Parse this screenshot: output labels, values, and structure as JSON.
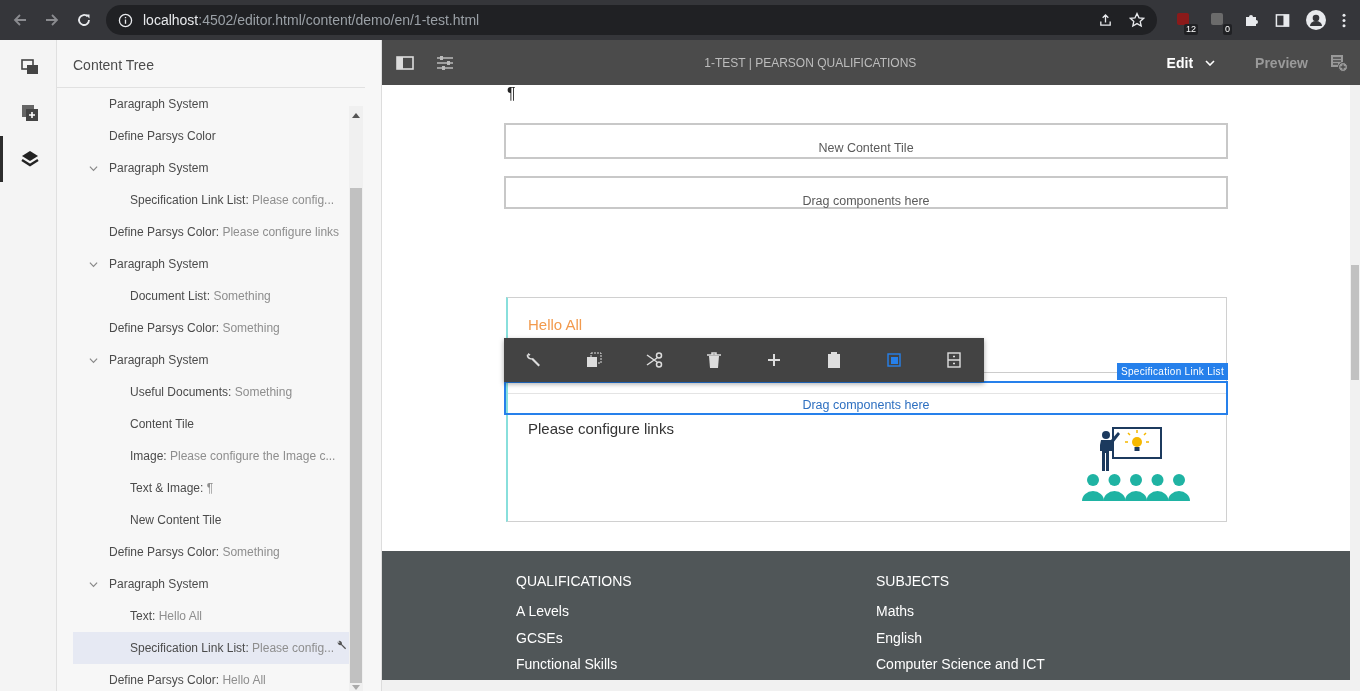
{
  "browser": {
    "url_host": "localhost",
    "url_path": ":4502/editor.html/content/demo/en/1-test.html",
    "badges": [
      "12",
      "0"
    ]
  },
  "rail": [
    {
      "selected": false
    },
    {
      "selected": false
    },
    {
      "selected": true
    }
  ],
  "content_tree": {
    "title": "Content Tree",
    "items": [
      {
        "label": "Paragraph System",
        "selected": false
      },
      {
        "label": "Define Parsys Color",
        "selected": false
      },
      {
        "label": "Paragraph System",
        "expanded": true,
        "selected": false,
        "children": [
          {
            "label": "Specification Link List:",
            "value": "Please config...",
            "selected": false
          }
        ]
      },
      {
        "label": "Define Parsys Color:",
        "value": "Please configure links",
        "selected": false
      },
      {
        "label": "Paragraph System",
        "expanded": true,
        "selected": false,
        "children": [
          {
            "label": "Document List:",
            "value": "Something",
            "selected": false
          }
        ]
      },
      {
        "label": "Define Parsys Color:",
        "value": "Something",
        "selected": false
      },
      {
        "label": "Paragraph System",
        "expanded": true,
        "selected": false,
        "children": [
          {
            "label": "Useful Documents:",
            "value": "Something",
            "selected": false
          },
          {
            "label": "Content Tile",
            "selected": false
          },
          {
            "label": "Image:",
            "value": "Please configure the Image c...",
            "selected": false
          },
          {
            "label": "Text & Image:",
            "value": "¶",
            "selected": false
          },
          {
            "label": "New Content Tile",
            "selected": false
          }
        ]
      },
      {
        "label": "Define Parsys Color:",
        "value": "Something",
        "selected": false
      },
      {
        "label": "Paragraph System",
        "expanded": true,
        "selected": false,
        "children": [
          {
            "label": "Text:",
            "value": "Hello All",
            "selected": false
          },
          {
            "label": "Specification Link List:",
            "value": "Please config...",
            "selected": true
          }
        ]
      },
      {
        "label": "Define Parsys Color:",
        "value": "Hello All",
        "selected": false
      }
    ]
  },
  "editor_bar": {
    "title": "1-TEST | PEARSON QUALIFICATIONS",
    "mode": "Edit",
    "preview": "Preview"
  },
  "page": {
    "pilcrow": "¶",
    "tile_title": "New Content Tile",
    "drop_zone": "Drag components here",
    "component": {
      "heading": "Hello All",
      "text": "Please configure links",
      "label": "Specification Link List",
      "drop_zone": "Drag components here"
    },
    "toolbar": [
      {
        "selected": false
      },
      {
        "selected": false
      },
      {
        "selected": false
      },
      {
        "selected": false
      },
      {
        "selected": false
      },
      {
        "selected": false
      },
      {
        "selected": true
      },
      {
        "selected": false
      }
    ],
    "footer": [
      {
        "heading": "QUALIFICATIONS",
        "links": [
          "A Levels",
          "GCSEs",
          "Functional Skills"
        ]
      },
      {
        "heading": "SUBJECTS",
        "links": [
          "Maths",
          "English",
          "Computer Science and ICT"
        ]
      }
    ]
  }
}
